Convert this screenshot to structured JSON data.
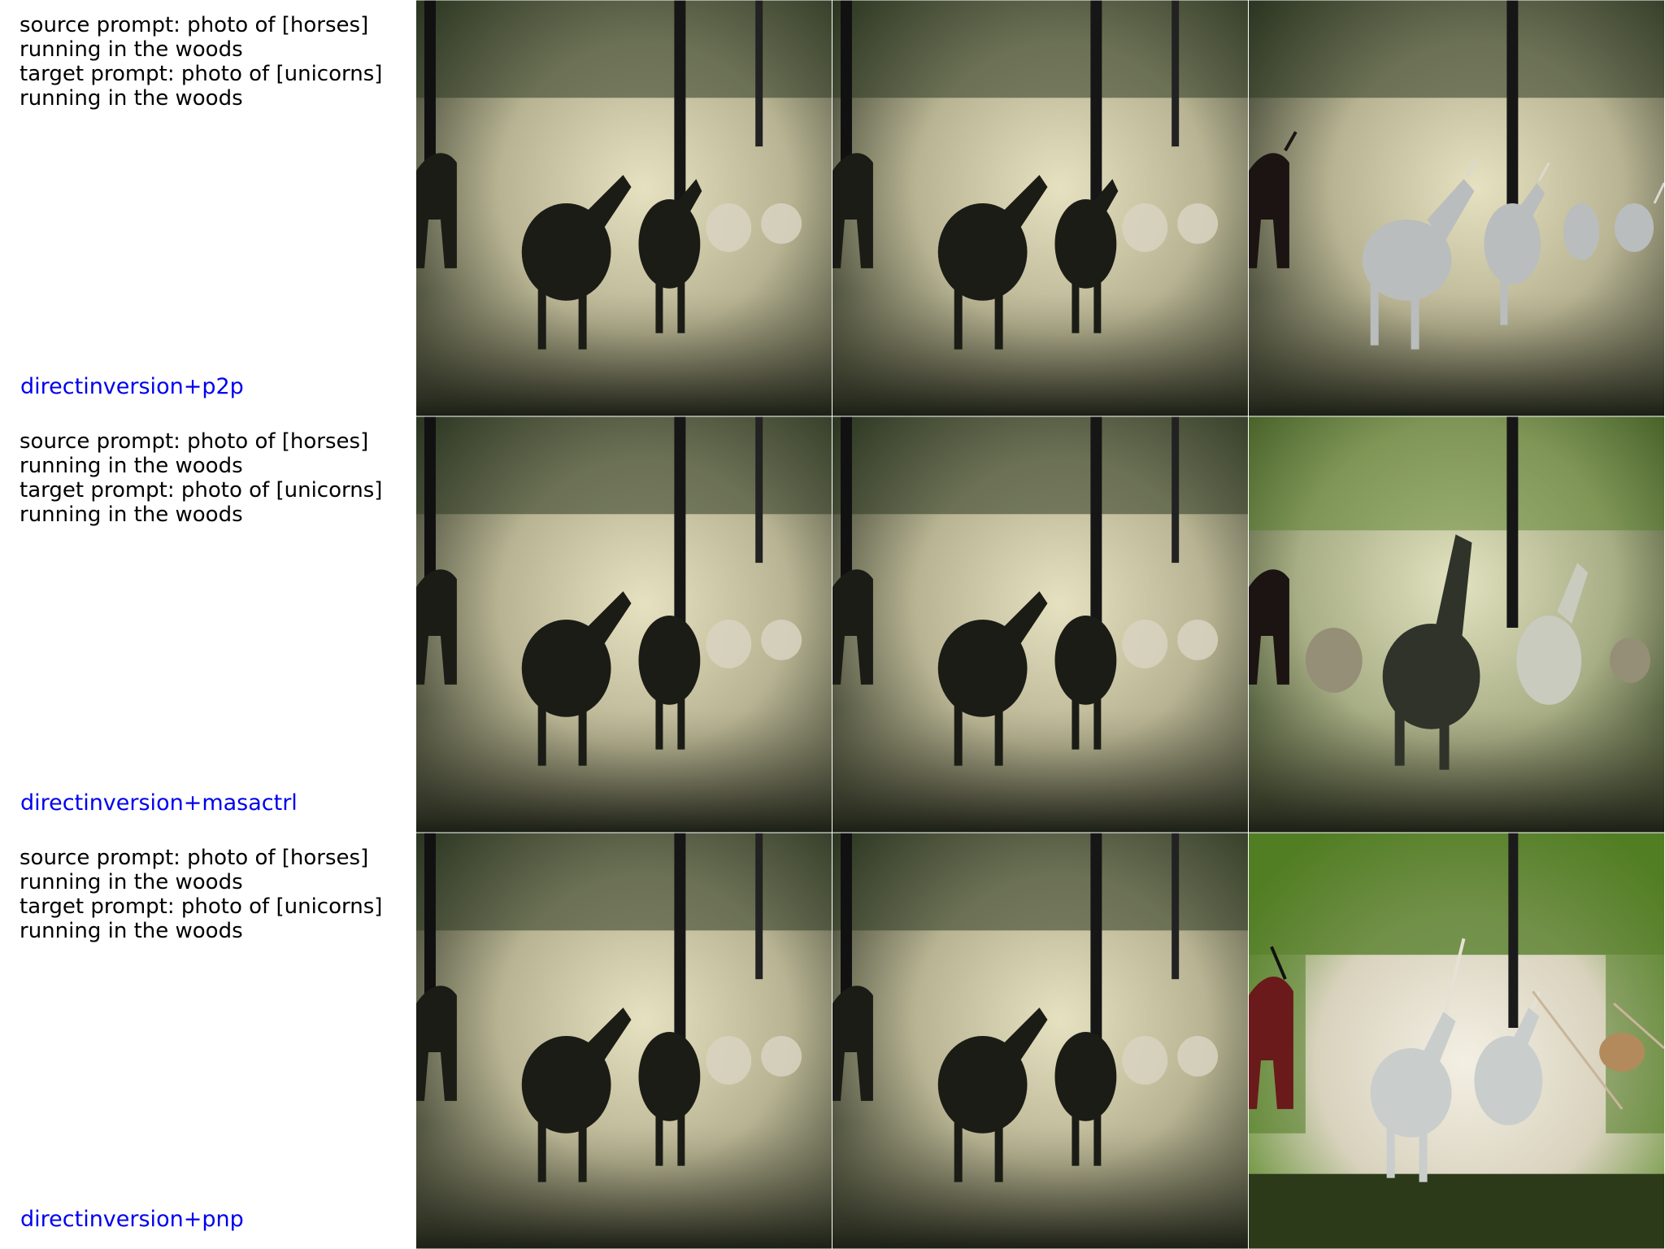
{
  "rows": [
    {
      "source_prompt": "source prompt: photo of [horses] running in the woods",
      "target_prompt": "target prompt: photo of [unicorns] running in the woods",
      "method": "directinversion+p2p",
      "panels": [
        "source-image",
        "reconstruction-image",
        "edited-image"
      ]
    },
    {
      "source_prompt": "source prompt: photo of [horses] running in the woods",
      "target_prompt": "target prompt: photo of [unicorns] running in the woods",
      "method": "directinversion+masactrl",
      "panels": [
        "source-image",
        "reconstruction-image",
        "edited-image"
      ]
    },
    {
      "source_prompt": "source prompt: photo of [horses] running in the woods",
      "target_prompt": "target prompt: photo of [unicorns] running in the woods",
      "method": "directinversion+pnp",
      "panels": [
        "source-image",
        "reconstruction-image",
        "edited-image"
      ]
    }
  ],
  "colors": {
    "method_label": "#0000ee",
    "fog": "#cfcaa6",
    "forest_dark": "#1d2417",
    "forest_green": "#4f7a22"
  }
}
